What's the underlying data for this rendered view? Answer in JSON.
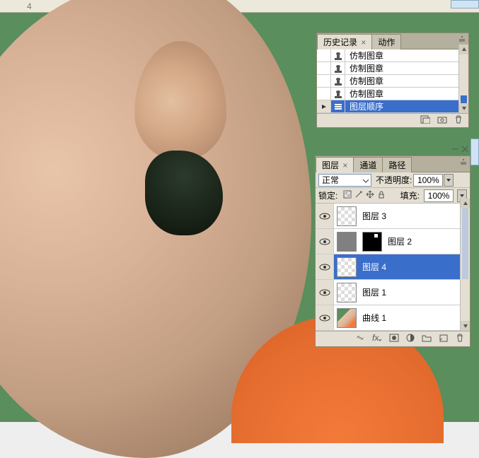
{
  "topbar": {
    "number": "4"
  },
  "history": {
    "tabs": [
      {
        "label": "历史记录",
        "active": true,
        "close": "×"
      },
      {
        "label": "动作",
        "active": false
      }
    ],
    "items": [
      {
        "icon": "stamp",
        "label": "仿制图章",
        "selected": false
      },
      {
        "icon": "stamp",
        "label": "仿制图章",
        "selected": false
      },
      {
        "icon": "stamp",
        "label": "仿制图章",
        "selected": false
      },
      {
        "icon": "stamp",
        "label": "仿制图章",
        "selected": false
      },
      {
        "icon": "layer-order",
        "label": "图层顺序",
        "selected": true
      }
    ]
  },
  "layers": {
    "tabs": [
      {
        "label": "图层",
        "active": true,
        "close": "×"
      },
      {
        "label": "通道",
        "active": false
      },
      {
        "label": "路径",
        "active": false
      }
    ],
    "blend": "正常",
    "opacity_label": "不透明度:",
    "opacity_value": "100%",
    "lock_label": "锁定:",
    "fill_label": "填充:",
    "fill_value": "100%",
    "items": [
      {
        "visible": true,
        "thumbs": [
          "checker"
        ],
        "name": "图层 3",
        "selected": false
      },
      {
        "visible": true,
        "thumbs": [
          "gray",
          "black"
        ],
        "name": "图层 2",
        "selected": false
      },
      {
        "visible": true,
        "thumbs": [
          "checker"
        ],
        "name": "图层 4",
        "selected": true
      },
      {
        "visible": true,
        "thumbs": [
          "checker"
        ],
        "name": "图层 1",
        "selected": false
      },
      {
        "visible": true,
        "thumbs": [
          "img"
        ],
        "name": "曲线 1",
        "selected": false
      }
    ]
  }
}
